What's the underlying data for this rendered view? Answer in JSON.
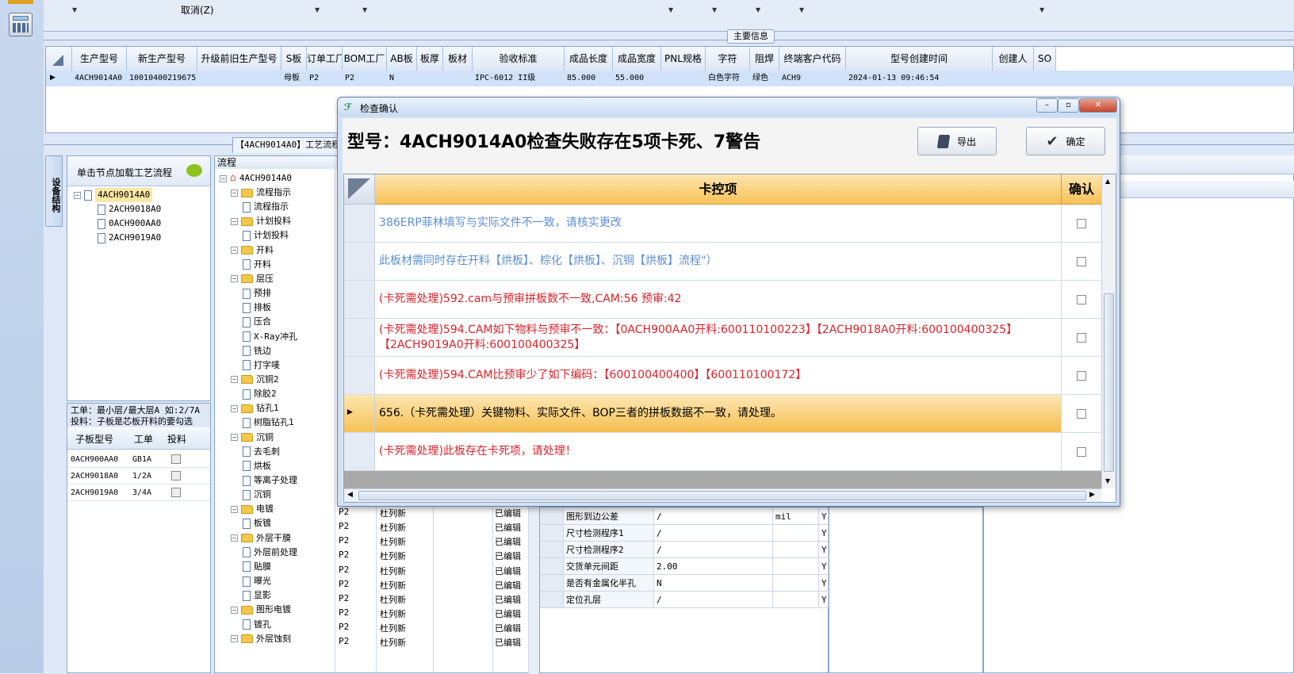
{
  "toolbar": {
    "cancel_label": "取消(Z)"
  },
  "main_info": {
    "section_title": "主要信息",
    "columns": [
      "生产型号",
      "新生产型号",
      "升级前旧生产型号",
      "S板",
      "订单工厂",
      "BOM工厂",
      "AB板",
      "板厚",
      "板材",
      "验收标准",
      "成品长度",
      "成品宽度",
      "PNL规格",
      "字符",
      "阻焊",
      "终端客户代码",
      "型号创建时间",
      "创建人",
      "SO"
    ],
    "row": [
      "4ACH9014A0",
      "10010400219675",
      "",
      "母板",
      "P2",
      "P2",
      "N",
      "",
      "",
      "IPC-6012 II级",
      "85.000",
      "55.000",
      "",
      "白色字符",
      "绿色",
      "ACH9",
      "2024-01-13 09:46:54",
      "",
      ""
    ]
  },
  "process_tab": {
    "label": "【4ACH9014A0】工艺流程"
  },
  "side_tab": {
    "label": "设备结构"
  },
  "tree_panel": {
    "hint": "单击节点加载工艺流程",
    "root": "4ACH9014A0",
    "children": [
      "2ACH9018A0",
      "0ACH900AA0",
      "2ACH9019A0"
    ]
  },
  "layer_info": {
    "line1": "工单：最小层/最大层A 如:2/7A",
    "line2": "投料：子板是芯板开料的要勾选",
    "columns": [
      "子板型号",
      "工单",
      "投料"
    ],
    "rows": [
      {
        "model": "0ACH900AA0",
        "order": "GB1A"
      },
      {
        "model": "2ACH9018A0",
        "order": "1/2A"
      },
      {
        "model": "2ACH9019A0",
        "order": "3/4A"
      }
    ]
  },
  "flow_tree": {
    "header": "流程",
    "root": "4ACH9014A0",
    "items": [
      {
        "label": "流程指示",
        "type": "folder"
      },
      {
        "label": "流程指示",
        "type": "doc"
      },
      {
        "label": "计划投料",
        "type": "folder"
      },
      {
        "label": "计划投料",
        "type": "doc"
      },
      {
        "label": "开料",
        "type": "folder"
      },
      {
        "label": "开料",
        "type": "doc"
      },
      {
        "label": "层压",
        "type": "folder"
      },
      {
        "label": "预排",
        "type": "doc"
      },
      {
        "label": "排板",
        "type": "doc"
      },
      {
        "label": "压合",
        "type": "doc"
      },
      {
        "label": "X-Ray冲孔",
        "type": "doc"
      },
      {
        "label": "铣边",
        "type": "doc"
      },
      {
        "label": "打字唛",
        "type": "doc"
      },
      {
        "label": "沉铜2",
        "type": "folder"
      },
      {
        "label": "除胶2",
        "type": "doc"
      },
      {
        "label": "钻孔1",
        "type": "folder"
      },
      {
        "label": "树脂钻孔1",
        "type": "doc"
      },
      {
        "label": "沉铜",
        "type": "folder"
      },
      {
        "label": "去毛刺",
        "type": "doc"
      },
      {
        "label": "烘板",
        "type": "doc"
      },
      {
        "label": "等离子处理",
        "type": "doc"
      },
      {
        "label": "沉铜",
        "type": "doc"
      },
      {
        "label": "电镀",
        "type": "folder"
      },
      {
        "label": "板镀",
        "type": "doc"
      },
      {
        "label": "外层干膜",
        "type": "folder"
      },
      {
        "label": "外层前处理",
        "type": "doc"
      },
      {
        "label": "贴膜",
        "type": "doc"
      },
      {
        "label": "曝光",
        "type": "doc"
      },
      {
        "label": "显影",
        "type": "doc"
      },
      {
        "label": "图形电镀",
        "type": "folder"
      },
      {
        "label": "镀孔",
        "type": "doc"
      },
      {
        "label": "外层蚀刻",
        "type": "folder"
      }
    ]
  },
  "flow_rows": {
    "factory": "P2",
    "person": "杜列新",
    "status": "已编辑",
    "count": 10
  },
  "params": {
    "rows": [
      {
        "name": "图形到边公差",
        "value": "/",
        "unit": "mil",
        "flag": "Y"
      },
      {
        "name": "尺寸检测程序1",
        "value": "/",
        "unit": "",
        "flag": "Y"
      },
      {
        "name": "尺寸检测程序2",
        "value": "/",
        "unit": "",
        "flag": "Y"
      },
      {
        "name": "交货单元间距",
        "value": "2.00",
        "unit": "",
        "flag": "Y"
      },
      {
        "name": "是否有金属化半孔",
        "value": "N",
        "unit": "",
        "flag": "Y"
      },
      {
        "name": "定位孔层",
        "value": "/",
        "unit": "",
        "flag": "Y"
      }
    ]
  },
  "dialog": {
    "title": "检查确认",
    "headline": "型号：4ACH9014A0检查失败存在5项卡死、7警告",
    "export_label": "导出",
    "confirm_label": "确定",
    "col_item": "卡控项",
    "col_confirm": "确认",
    "rows": [
      {
        "text": "386ERP菲林填写与实际文件不一致，请核实更改",
        "color": "#5b8fd6",
        "selected": false
      },
      {
        "text": "此板材需同时存在开料【烘板】、棕化【烘板】、沉铜【烘板】流程\"）",
        "color": "#5b8fd6",
        "selected": false
      },
      {
        "text": "(卡死需处理)592.cam与预审拼板数不一致,CAM:56 预审:42",
        "color": "#d8242a",
        "selected": false
      },
      {
        "text": "(卡死需处理)594.CAM如下物料与预审不一致：【0ACH900AA0开料:600110100223】【2ACH9018A0开料:600100400325】【2ACH9019A0开料:600100400325】",
        "color": "#d8242a",
        "selected": false
      },
      {
        "text": "(卡死需处理)594.CAM比预审少了如下编码：【600100400400】【600110100172】",
        "color": "#d8242a",
        "selected": false
      },
      {
        "text": "656.（卡死需处理）关键物料、实际文件、BOP三者的拼板数据不一致，请处理。",
        "color": "#000000",
        "selected": true
      },
      {
        "text": "(卡死需处理)此板存在卡死项，请处理！",
        "color": "#d8242a",
        "selected": false
      }
    ]
  }
}
